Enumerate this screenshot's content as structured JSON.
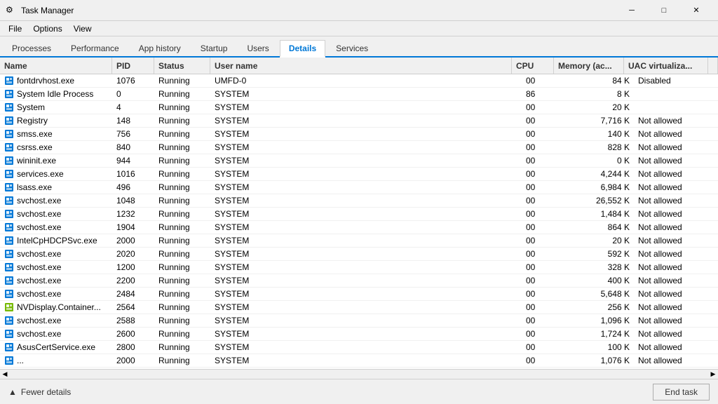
{
  "titleBar": {
    "icon": "⚙",
    "title": "Task Manager",
    "minimizeLabel": "─",
    "maximizeLabel": "□",
    "closeLabel": "✕"
  },
  "menuBar": {
    "items": [
      "File",
      "Options",
      "View"
    ]
  },
  "tabs": [
    {
      "label": "Processes",
      "active": false
    },
    {
      "label": "Performance",
      "active": false
    },
    {
      "label": "App history",
      "active": false
    },
    {
      "label": "Startup",
      "active": false
    },
    {
      "label": "Users",
      "active": false
    },
    {
      "label": "Details",
      "active": true
    },
    {
      "label": "Services",
      "active": false
    }
  ],
  "tableHeaders": [
    {
      "label": "Name"
    },
    {
      "label": "PID"
    },
    {
      "label": "Status"
    },
    {
      "label": "User name"
    },
    {
      "label": "CPU"
    },
    {
      "label": "Memory (ac..."
    },
    {
      "label": "UAC virtualiza..."
    }
  ],
  "processes": [
    {
      "name": "fontdrvhost.exe",
      "pid": "1076",
      "status": "Running",
      "user": "UMFD-0",
      "cpu": "00",
      "memory": "84 K",
      "uac": "Disabled"
    },
    {
      "name": "System Idle Process",
      "pid": "0",
      "status": "Running",
      "user": "SYSTEM",
      "cpu": "86",
      "memory": "8 K",
      "uac": ""
    },
    {
      "name": "System",
      "pid": "4",
      "status": "Running",
      "user": "SYSTEM",
      "cpu": "00",
      "memory": "20 K",
      "uac": ""
    },
    {
      "name": "Registry",
      "pid": "148",
      "status": "Running",
      "user": "SYSTEM",
      "cpu": "00",
      "memory": "7,716 K",
      "uac": "Not allowed"
    },
    {
      "name": "smss.exe",
      "pid": "756",
      "status": "Running",
      "user": "SYSTEM",
      "cpu": "00",
      "memory": "140 K",
      "uac": "Not allowed"
    },
    {
      "name": "csrss.exe",
      "pid": "840",
      "status": "Running",
      "user": "SYSTEM",
      "cpu": "00",
      "memory": "828 K",
      "uac": "Not allowed"
    },
    {
      "name": "wininit.exe",
      "pid": "944",
      "status": "Running",
      "user": "SYSTEM",
      "cpu": "00",
      "memory": "0 K",
      "uac": "Not allowed"
    },
    {
      "name": "services.exe",
      "pid": "1016",
      "status": "Running",
      "user": "SYSTEM",
      "cpu": "00",
      "memory": "4,244 K",
      "uac": "Not allowed"
    },
    {
      "name": "lsass.exe",
      "pid": "496",
      "status": "Running",
      "user": "SYSTEM",
      "cpu": "00",
      "memory": "6,984 K",
      "uac": "Not allowed"
    },
    {
      "name": "svchost.exe",
      "pid": "1048",
      "status": "Running",
      "user": "SYSTEM",
      "cpu": "00",
      "memory": "26,552 K",
      "uac": "Not allowed"
    },
    {
      "name": "svchost.exe",
      "pid": "1232",
      "status": "Running",
      "user": "SYSTEM",
      "cpu": "00",
      "memory": "1,484 K",
      "uac": "Not allowed"
    },
    {
      "name": "svchost.exe",
      "pid": "1904",
      "status": "Running",
      "user": "SYSTEM",
      "cpu": "00",
      "memory": "864 K",
      "uac": "Not allowed"
    },
    {
      "name": "IntelCpHDCPSvc.exe",
      "pid": "2000",
      "status": "Running",
      "user": "SYSTEM",
      "cpu": "00",
      "memory": "20 K",
      "uac": "Not allowed"
    },
    {
      "name": "svchost.exe",
      "pid": "2020",
      "status": "Running",
      "user": "SYSTEM",
      "cpu": "00",
      "memory": "592 K",
      "uac": "Not allowed"
    },
    {
      "name": "svchost.exe",
      "pid": "1200",
      "status": "Running",
      "user": "SYSTEM",
      "cpu": "00",
      "memory": "328 K",
      "uac": "Not allowed"
    },
    {
      "name": "svchost.exe",
      "pid": "2200",
      "status": "Running",
      "user": "SYSTEM",
      "cpu": "00",
      "memory": "400 K",
      "uac": "Not allowed"
    },
    {
      "name": "svchost.exe",
      "pid": "2484",
      "status": "Running",
      "user": "SYSTEM",
      "cpu": "00",
      "memory": "5,648 K",
      "uac": "Not allowed"
    },
    {
      "name": "NVDisplay.Container...",
      "pid": "2564",
      "status": "Running",
      "user": "SYSTEM",
      "cpu": "00",
      "memory": "256 K",
      "uac": "Not allowed"
    },
    {
      "name": "svchost.exe",
      "pid": "2588",
      "status": "Running",
      "user": "SYSTEM",
      "cpu": "00",
      "memory": "1,096 K",
      "uac": "Not allowed"
    },
    {
      "name": "svchost.exe",
      "pid": "2600",
      "status": "Running",
      "user": "SYSTEM",
      "cpu": "00",
      "memory": "1,724 K",
      "uac": "Not allowed"
    },
    {
      "name": "AsusCertService.exe",
      "pid": "2800",
      "status": "Running",
      "user": "SYSTEM",
      "cpu": "00",
      "memory": "100 K",
      "uac": "Not allowed"
    },
    {
      "name": "...",
      "pid": "2000",
      "status": "Running",
      "user": "SYSTEM",
      "cpu": "00",
      "memory": "1,076 K",
      "uac": "Not allowed"
    }
  ],
  "bottomBar": {
    "fewerDetailsLabel": "Fewer details",
    "endTaskLabel": "End task"
  }
}
